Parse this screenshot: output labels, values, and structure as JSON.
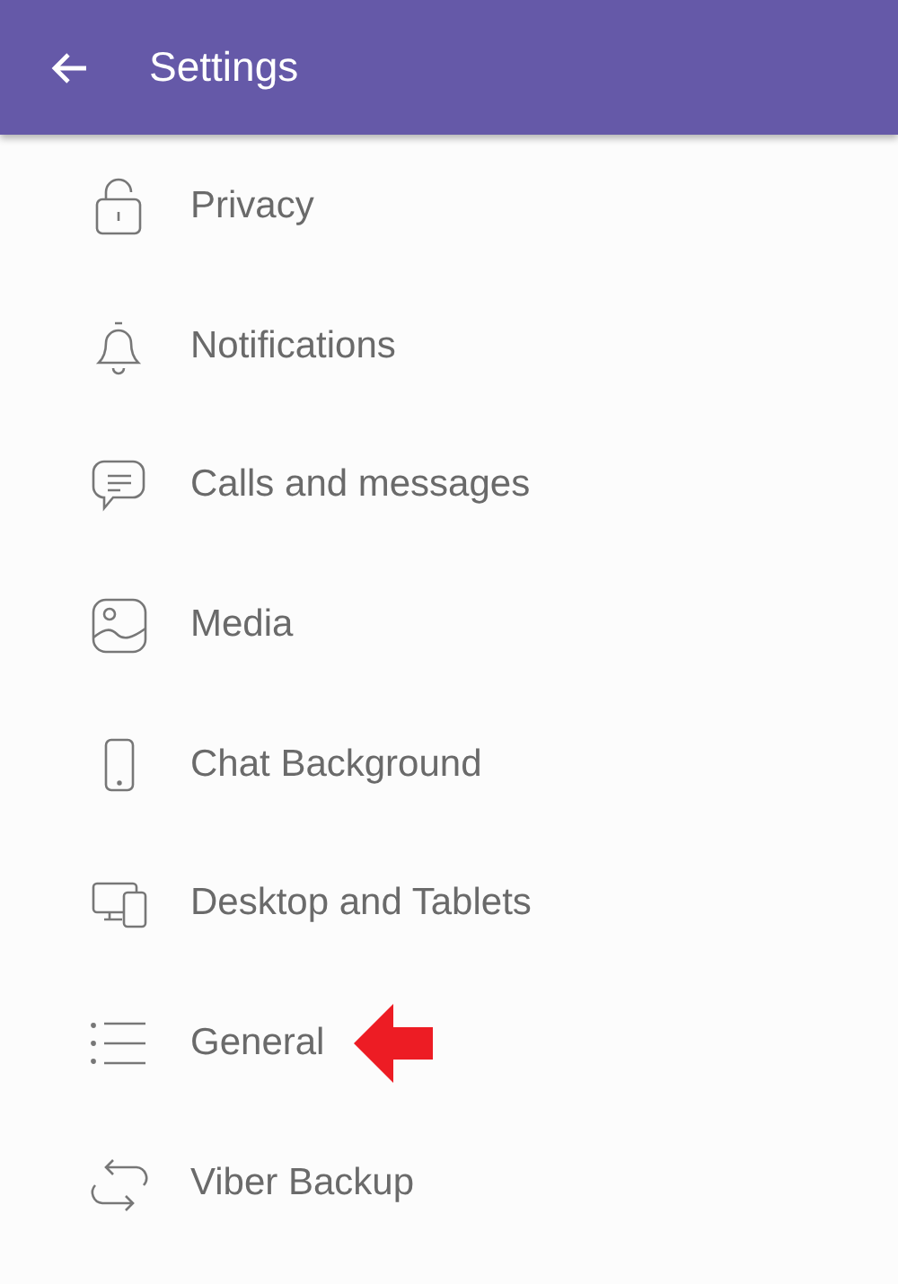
{
  "app_bar": {
    "title": "Settings"
  },
  "items": [
    {
      "label": "Privacy",
      "kind": "lock",
      "pointed": false
    },
    {
      "label": "Notifications",
      "kind": "bell",
      "pointed": false
    },
    {
      "label": "Calls and messages",
      "kind": "chat",
      "pointed": false
    },
    {
      "label": "Media",
      "kind": "image",
      "pointed": false
    },
    {
      "label": "Chat Background",
      "kind": "phone",
      "pointed": false
    },
    {
      "label": "Desktop and Tablets",
      "kind": "devices",
      "pointed": false
    },
    {
      "label": "General",
      "kind": "list",
      "pointed": true
    },
    {
      "label": "Viber Backup",
      "kind": "sync",
      "pointed": false
    }
  ]
}
